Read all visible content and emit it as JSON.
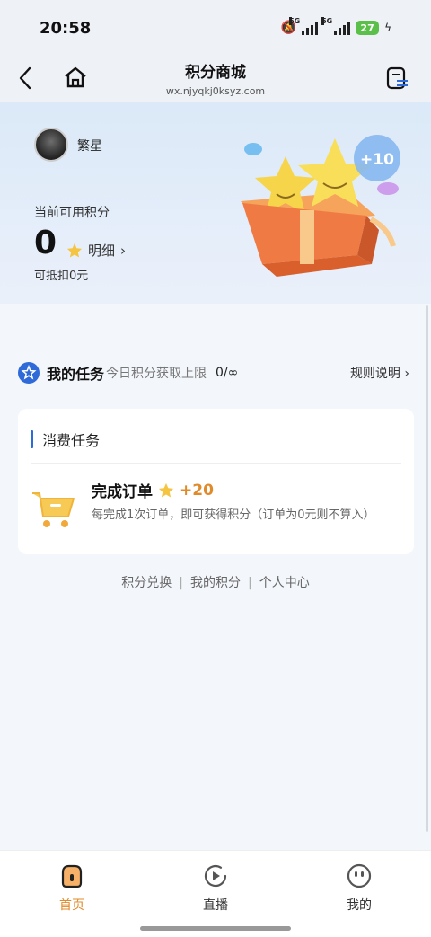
{
  "status_bar": {
    "time": "20:58",
    "network_1": "5G",
    "network_2": "5G",
    "battery": "27",
    "icons": [
      "mute-icon",
      "signal-icon",
      "signal-icon",
      "battery-icon",
      "charging-icon"
    ]
  },
  "nav": {
    "title": "积分商城",
    "url": "wx.njyqkj0ksyz.com",
    "icons": [
      "back-icon",
      "home-icon",
      "menu-icon"
    ]
  },
  "profile": {
    "username": "繁星",
    "points_label": "当前可用积分",
    "points_value": "0",
    "detail_label": "明细",
    "detail_arrow": "›",
    "deduct_text": "可抵扣0元",
    "gift_badge": "+10"
  },
  "tasks": {
    "title": "我的任务",
    "today_limit_label": "今日积分获取上限",
    "today_limit_value": "0/∞",
    "rules_label": "规则说明",
    "rules_arrow": "›"
  },
  "task_card": {
    "section_title": "消费任务",
    "order_title": "完成订单",
    "order_points": "+20",
    "order_desc": "每完成1次订单，即可获得积分（订单为0元则不算入）"
  },
  "footer_links": [
    "积分兑换",
    "我的积分",
    "个人中心"
  ],
  "tab_bar": {
    "items": [
      {
        "label": "首页",
        "icon": "home-tab-icon",
        "active": true
      },
      {
        "label": "直播",
        "icon": "live-play-icon",
        "active": false
      },
      {
        "label": "我的",
        "icon": "profile-face-icon",
        "active": false
      }
    ]
  },
  "colors": {
    "accent": "#e08a2a",
    "brand_blue": "#2f6bd8",
    "battery_green": "#5bc04a"
  }
}
